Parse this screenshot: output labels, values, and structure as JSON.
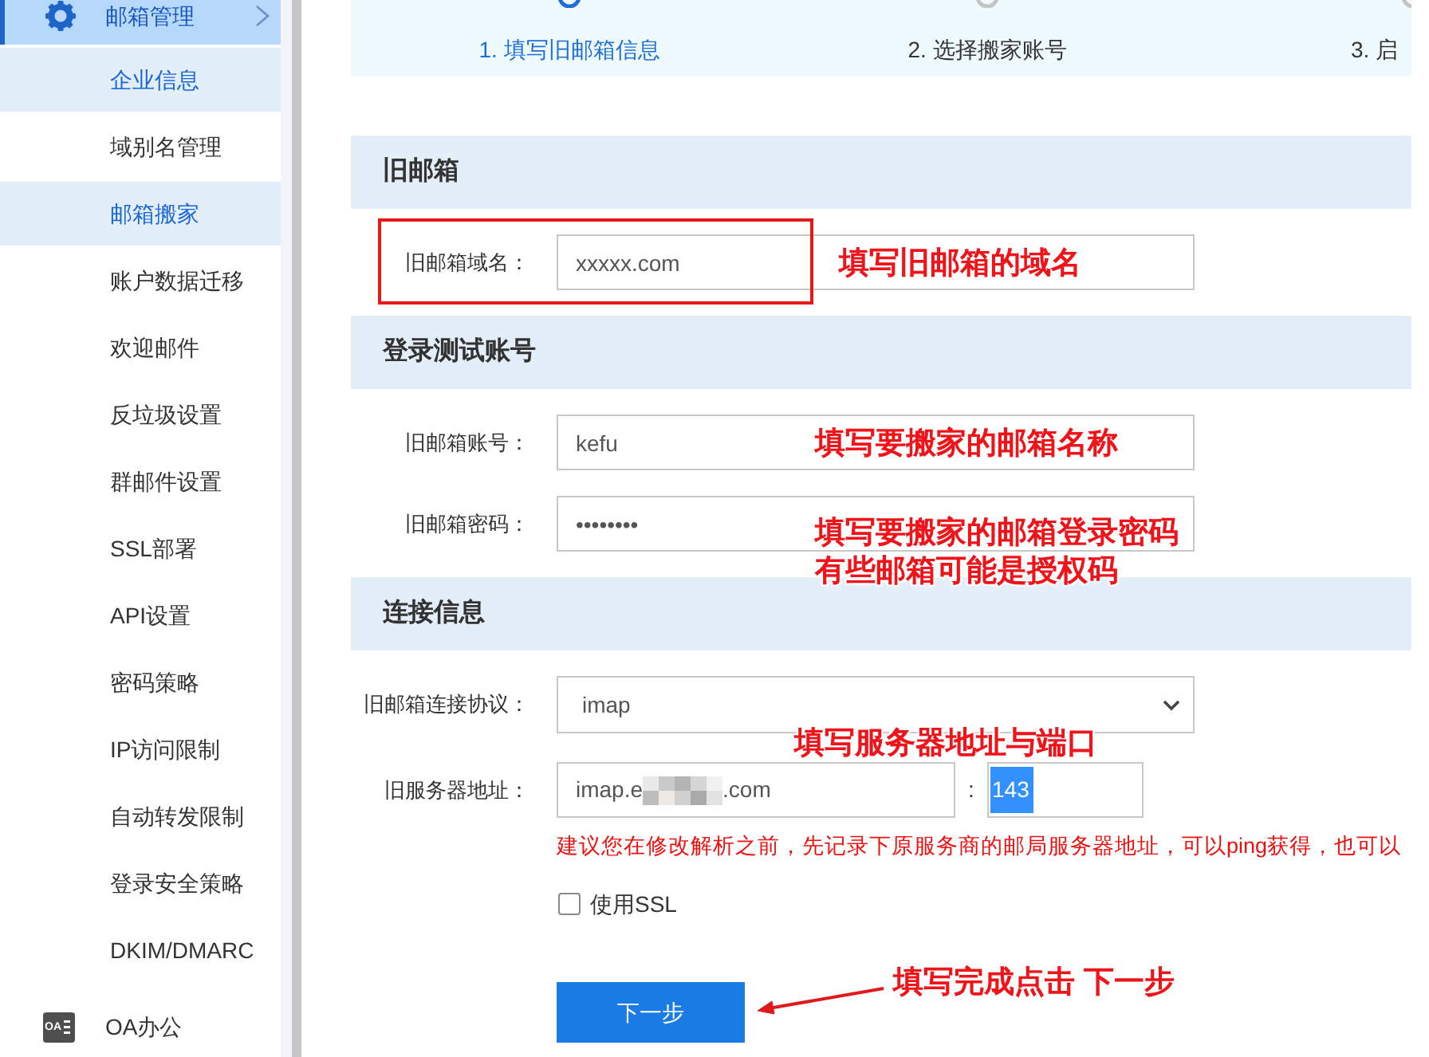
{
  "sidebar": {
    "group": {
      "label": "邮箱管理",
      "selected": true
    },
    "items": [
      {
        "label": "企业信息",
        "selected": true
      },
      {
        "label": "域别名管理",
        "selected": false
      },
      {
        "label": "邮箱搬家",
        "selected": true
      },
      {
        "label": "账户数据迁移",
        "selected": false
      },
      {
        "label": "欢迎邮件",
        "selected": false
      },
      {
        "label": "反垃圾设置",
        "selected": false
      },
      {
        "label": "群邮件设置",
        "selected": false
      },
      {
        "label": "SSL部署",
        "selected": false
      },
      {
        "label": "API设置",
        "selected": false
      },
      {
        "label": "密码策略",
        "selected": false
      },
      {
        "label": "IP访问限制",
        "selected": false
      },
      {
        "label": "自动转发限制",
        "selected": false
      },
      {
        "label": "登录安全策略",
        "selected": false
      },
      {
        "label": "DKIM/DMARC",
        "selected": false
      }
    ],
    "bottom_item": {
      "icon_text": "OA",
      "label": "OA办公"
    }
  },
  "steps": [
    {
      "label": "1. 填写旧邮箱信息",
      "active": true
    },
    {
      "label": "2. 选择搬家账号",
      "active": false
    },
    {
      "label": "3. 启",
      "active": false
    }
  ],
  "sections": [
    {
      "title": "旧邮箱",
      "fields": [
        {
          "kind": "text",
          "label": "旧邮箱域名：",
          "value": "xxxxx.com",
          "note": {
            "kind": "boxed",
            "lines": [
              "填写旧邮箱的域名"
            ]
          }
        }
      ]
    },
    {
      "title": "登录测试账号",
      "fields": [
        {
          "kind": "text",
          "label": "旧邮箱账号：",
          "value": "kefu",
          "note": {
            "kind": "inline",
            "lines": [
              "填写要搬家的邮箱名称"
            ]
          }
        },
        {
          "kind": "text",
          "label": "旧邮箱密码：",
          "value": "••••••••",
          "note": {
            "kind": "inline",
            "lines": [
              "填写要搬家的邮箱登录密码",
              "有些邮箱可能是授权码"
            ]
          }
        }
      ]
    },
    {
      "title": "连接信息",
      "fields": [
        {
          "kind": "select",
          "label": "旧邮箱连接协议：",
          "value": "imap"
        },
        {
          "kind": "server",
          "label": "旧服务器地址：",
          "value_start": "imap.e",
          "redacted": true,
          "value_end": ".com",
          "separator": ":",
          "port": "143",
          "port_selected": true,
          "note": {
            "kind": "above",
            "lines": [
              "填写服务器地址与端口"
            ]
          }
        }
      ],
      "hint": "建议您在修改解析之前，先记录下原服务商的邮局服务器地址，可以ping获得，也可以",
      "checkbox": {
        "label": "使用SSL",
        "checked": false
      }
    }
  ],
  "next_button": {
    "label": "下一步",
    "note": {
      "kind": "arrow",
      "lines": [
        "填写完成点击 下一步"
      ]
    }
  }
}
